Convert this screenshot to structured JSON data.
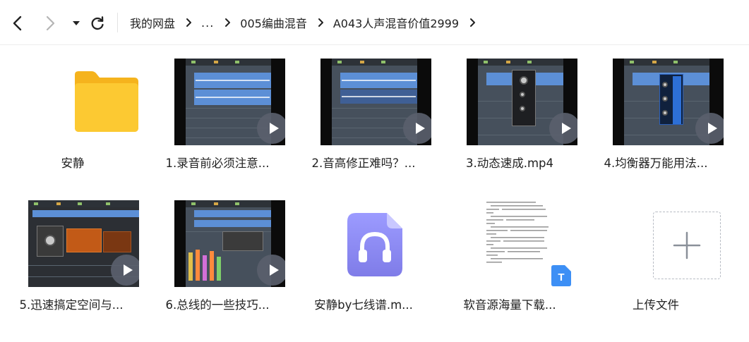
{
  "toolbar": {
    "back_icon": "chevron-left-icon",
    "forward_icon": "chevron-right-icon",
    "dropdown_icon": "caret-down-icon",
    "refresh_icon": "refresh-icon"
  },
  "breadcrumb": {
    "items": [
      "我的网盘",
      "...",
      "005编曲混音",
      "A043人声混音价值2999"
    ]
  },
  "files": [
    {
      "name": "安静",
      "type": "folder",
      "icon": "folder-icon"
    },
    {
      "name": "1.录音前必须注意...",
      "type": "video"
    },
    {
      "name": "2.音高修正难吗？...",
      "type": "video"
    },
    {
      "name": "3.动态速成.mp4",
      "type": "video"
    },
    {
      "name": "4.均衡器万能用法...",
      "type": "video"
    },
    {
      "name": "5.迅速搞定空间与...",
      "type": "video"
    },
    {
      "name": "6.总线的一些技巧...",
      "type": "video"
    },
    {
      "name": "安静by七线谱.m...",
      "type": "audio",
      "icon": "headphones-icon"
    },
    {
      "name": "软音源海量下载...",
      "type": "text",
      "badge": "T"
    },
    {
      "name": "上传文件",
      "type": "upload",
      "icon": "plus-icon"
    }
  ],
  "colors": {
    "folder": "#fcc932",
    "audio_icon": "#8f8df5",
    "text_badge": "#3d8ff5",
    "play_button": "#5a606c"
  }
}
